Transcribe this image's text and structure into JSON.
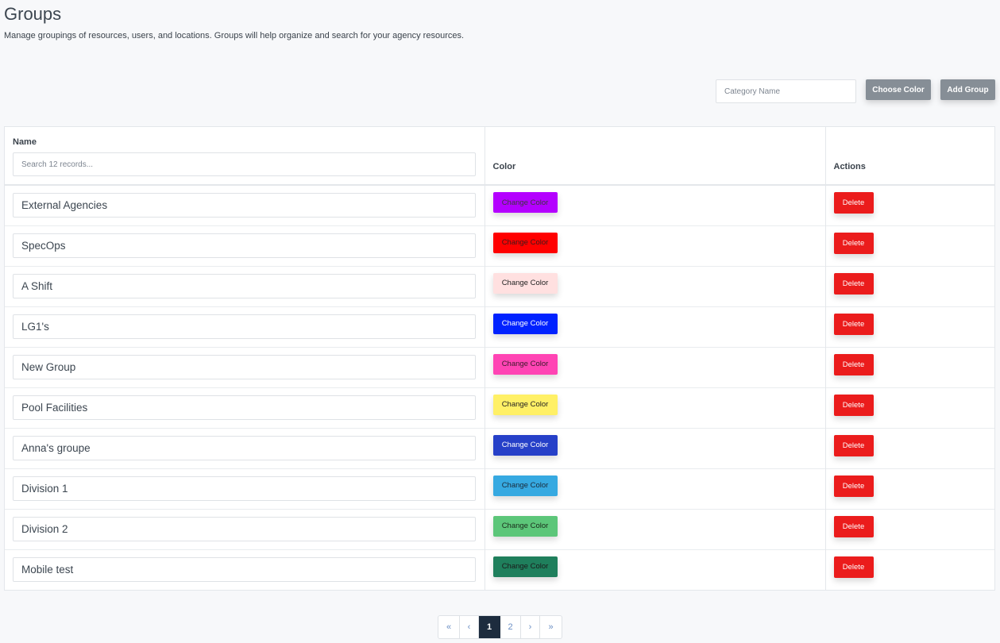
{
  "header": {
    "title": "Groups",
    "description": "Manage groupings of resources, users, and locations. Groups will help organize and search for your agency resources."
  },
  "toolbar": {
    "category_placeholder": "Category Name",
    "category_value": "",
    "choose_color_label": "Choose Color",
    "add_group_label": "Add Group"
  },
  "table": {
    "columns": {
      "name": "Name",
      "color": "Color",
      "actions": "Actions"
    },
    "search_placeholder": "Search 12 records...",
    "change_color_label": "Change Color",
    "delete_label": "Delete",
    "rows": [
      {
        "name": "External Agencies",
        "color": "#b400ff",
        "text_color": "#3a3a3a"
      },
      {
        "name": "SpecOps",
        "color": "#ff0000",
        "text_color": "#3a1a1a"
      },
      {
        "name": "A Shift",
        "color": "#ffe0e0",
        "text_color": "#222222"
      },
      {
        "name": "LG1's",
        "color": "#0022ff",
        "text_color": "#ffffff"
      },
      {
        "name": "New Group",
        "color": "#ff44b4",
        "text_color": "#3a1a2a"
      },
      {
        "name": "Pool Facilities",
        "color": "#fff066",
        "text_color": "#222222"
      },
      {
        "name": "Anna's groupe",
        "color": "#2640c8",
        "text_color": "#ffffff"
      },
      {
        "name": "Division 1",
        "color": "#36a9e1",
        "text_color": "#1a2a3a"
      },
      {
        "name": "Division 2",
        "color": "#5cc679",
        "text_color": "#1a2a1a"
      },
      {
        "name": "Mobile test",
        "color": "#1f7f5c",
        "text_color": "#1a1a1a"
      }
    ]
  },
  "pagination": {
    "first": "«",
    "prev": "‹",
    "pages": [
      "1",
      "2"
    ],
    "current": "1",
    "next": "›",
    "last": "»"
  }
}
